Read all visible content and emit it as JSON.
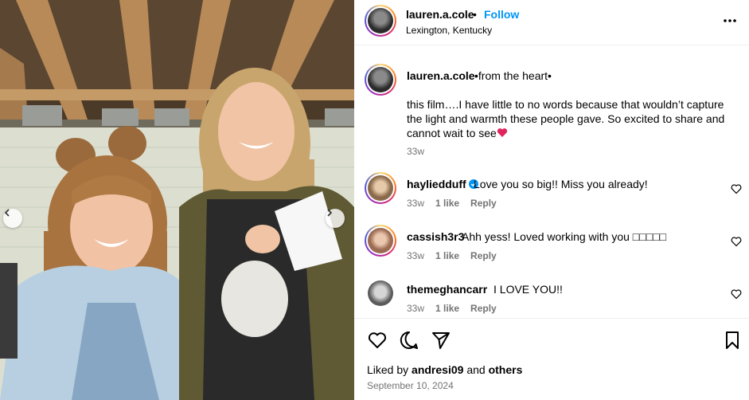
{
  "post": {
    "username": "lauren.a.cole",
    "follow_label": "Follow",
    "separator": "•",
    "location": "Lexington, Kentucky"
  },
  "caption": {
    "username": "lauren.a.cole",
    "tagline": "•from the heart•",
    "text": "this film….I have little to no words because that wouldn’t capture the light and warmth these people gave. So excited to share and cannot wait to see",
    "time": "33w"
  },
  "comments": [
    {
      "username": "hayliedduff",
      "text": "Love you so big!! Miss you already!",
      "time": "33w",
      "likes": "1 like",
      "reply": "Reply",
      "verified": true
    },
    {
      "username": "cassish3r3",
      "text": "Ahh yess! Loved working with you □□□□□",
      "time": "33w",
      "likes": "1 like",
      "reply": "Reply",
      "verified": false
    },
    {
      "username": "themeghancarr",
      "text": "I LOVE YOU!!",
      "time": "33w",
      "likes": "1 like",
      "reply": "Reply",
      "verified": false
    }
  ],
  "footer": {
    "liked_prefix": "Liked by",
    "liked_user": "andresi09",
    "liked_and": "and",
    "liked_others": "others",
    "date": "September 10, 2024"
  },
  "icons": {
    "more": "more-options-icon",
    "like": "heart-outline-icon",
    "comment": "comment-bubble-icon",
    "share": "paper-plane-icon",
    "save": "bookmark-icon",
    "prev": "chevron-left-icon",
    "next": "chevron-right-icon"
  },
  "colors": {
    "accent": "#0095f6",
    "muted": "#737373",
    "verified": "#0095f6",
    "heart": "#e0245e"
  }
}
